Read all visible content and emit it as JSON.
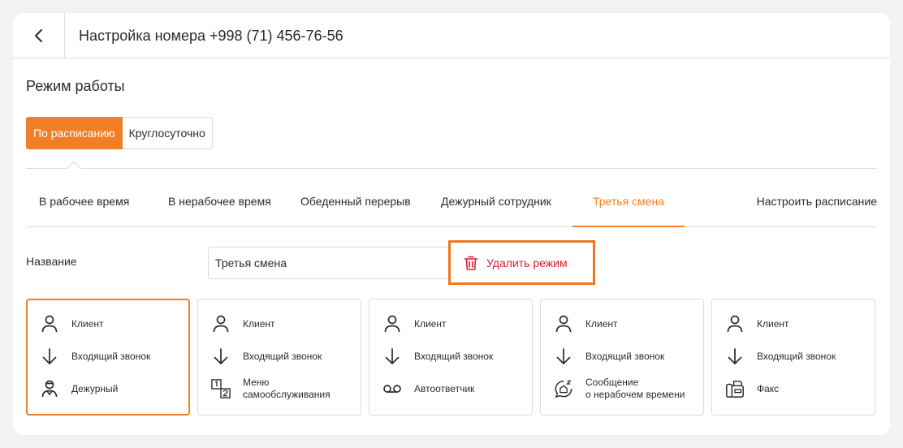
{
  "header": {
    "title": "Настройка номера +998 (71) 456-76-56",
    "back_icon": "chevron-left-icon"
  },
  "mode": {
    "title": "Режим работы",
    "options": [
      {
        "label": "По расписанию",
        "active": true
      },
      {
        "label": "Круглосуточно",
        "active": false
      }
    ]
  },
  "tabs": {
    "items": [
      {
        "label": "В рабочее время"
      },
      {
        "label": "В нерабочее время"
      },
      {
        "label": "Обеденный перерыв"
      },
      {
        "label": "Дежурный сотрудник"
      },
      {
        "label": "Третья смена",
        "active": true
      }
    ],
    "schedule_link": "Настроить расписание"
  },
  "name_field": {
    "label": "Название",
    "value": "Третья смена"
  },
  "delete_button": {
    "label": "Удалить режим",
    "color": "#d81b34",
    "highlight": "#ef7622"
  },
  "accent_color": "#f07f27",
  "scenarios": [
    {
      "active": true,
      "client": "Клиент",
      "call": "Входящий звонок",
      "action": "Дежурный",
      "action_icon": "duty-person-icon"
    },
    {
      "active": false,
      "client": "Клиент",
      "call": "Входящий звонок",
      "action": "Меню\nсамообслуживания",
      "action_icon": "ivr-menu-icon"
    },
    {
      "active": false,
      "client": "Клиент",
      "call": "Входящий звонок",
      "action": "Автоответчик",
      "action_icon": "voicemail-icon"
    },
    {
      "active": false,
      "client": "Клиент",
      "call": "Входящий звонок",
      "action": "Сообщение\nо нерабочем времени",
      "action_icon": "sleep-message-icon"
    },
    {
      "active": false,
      "client": "Клиент",
      "call": "Входящий звонок",
      "action": "Факс",
      "action_icon": "fax-icon"
    }
  ]
}
